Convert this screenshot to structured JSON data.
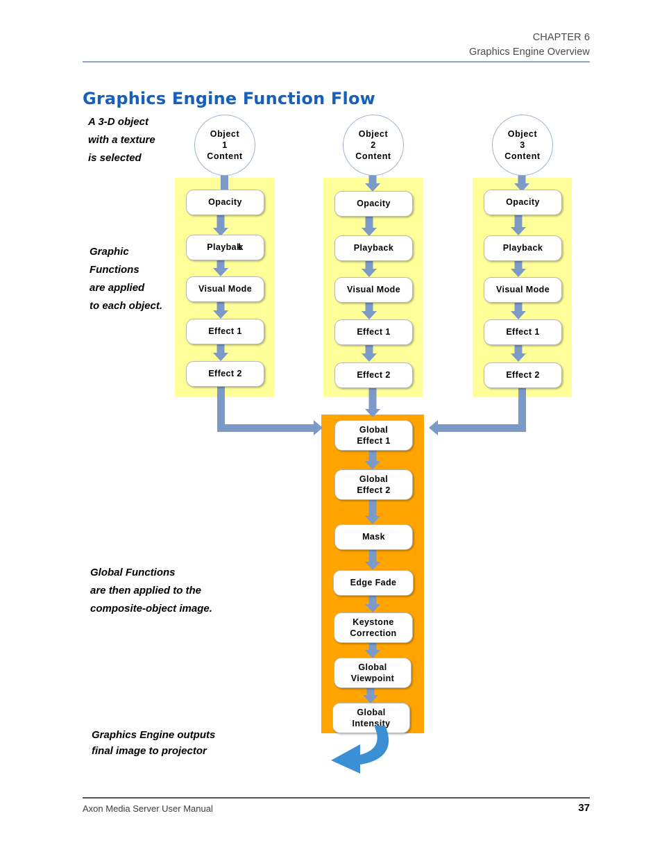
{
  "header": {
    "chapter": "CHAPTER 6",
    "section": "Graphics Engine Overview"
  },
  "title": "Graphics Engine Function Flow",
  "footer": {
    "manual": "Axon Media Server User Manual",
    "page_number": "37"
  },
  "annotations": {
    "object_selected": [
      "A 3-D object",
      "with a texture",
      "is selected"
    ],
    "graphic_functions": [
      "Graphic",
      "Functions",
      "are applied",
      "to each object."
    ],
    "global_functions": [
      "Global Functions",
      "are then applied to the",
      "composite-object image."
    ],
    "output": [
      "Graphics Engine outputs",
      "final image to projector"
    ]
  },
  "colors": {
    "title_blue": "#1560BD",
    "object_panel": "#FFFF99",
    "global_panel": "#FFA400",
    "arrow": "#7B9AC8",
    "output_arrow": "#3B8FD4",
    "circle_outline": "#9FB4CF"
  },
  "object_columns": [
    {
      "circle": [
        "Object",
        "1",
        "Content"
      ],
      "steps": [
        "Opacity",
        "Playbak",
        "Visual Mode",
        "Effect 1",
        "Effect 2"
      ]
    },
    {
      "circle": [
        "Object",
        "2",
        "Content"
      ],
      "steps": [
        "Opacity",
        "Playback",
        "Visual Mode",
        "Effect 1",
        "Effect 2"
      ]
    },
    {
      "circle": [
        "Object",
        "3",
        "Content"
      ],
      "steps": [
        "Opacity",
        "Playback",
        "Visual Mode",
        "Effect 1",
        "Effect 2"
      ]
    }
  ],
  "global_steps": [
    [
      "Global",
      "Effect 1"
    ],
    [
      "Global",
      "Effect 2"
    ],
    [
      "Mask"
    ],
    [
      "Edge Fade"
    ],
    [
      "Keystone",
      "Correction"
    ],
    [
      "Global",
      "Viewpoint"
    ],
    [
      "Global",
      "Intensity"
    ]
  ]
}
